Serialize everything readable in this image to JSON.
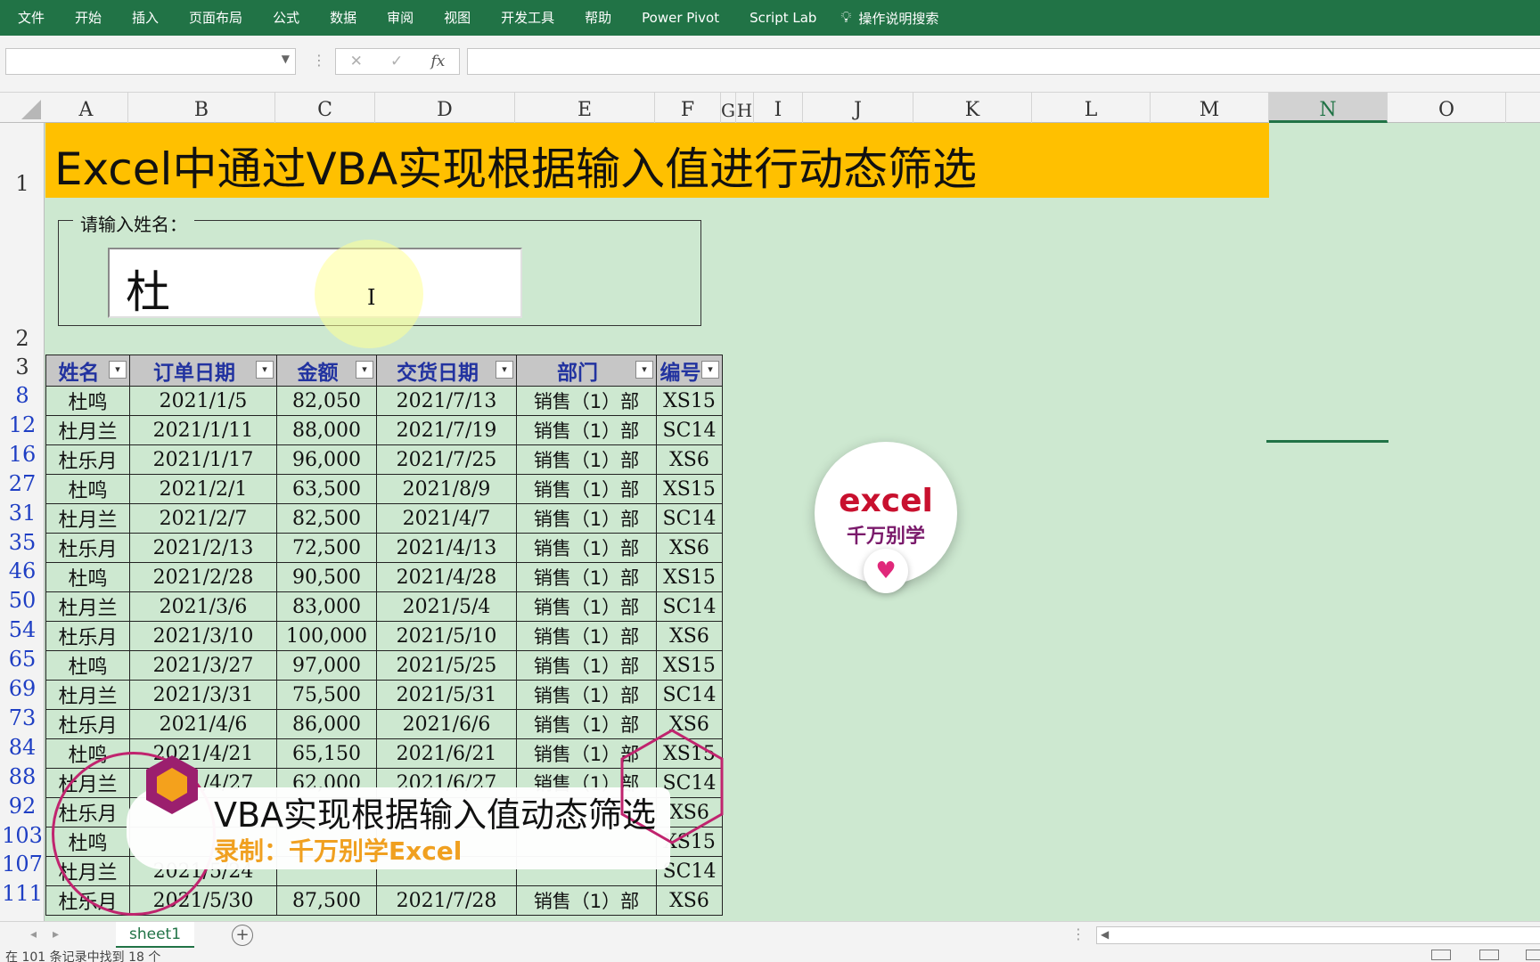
{
  "ribbon": {
    "tabs": [
      "文件",
      "开始",
      "插入",
      "页面布局",
      "公式",
      "数据",
      "审阅",
      "视图",
      "开发工具",
      "帮助",
      "Power Pivot",
      "Script Lab"
    ],
    "search_label": "操作说明搜索"
  },
  "formula_bar": {
    "fx": "fx",
    "cancel": "✕",
    "enter": "✓",
    "name_box": "",
    "content": ""
  },
  "columns": [
    "A",
    "B",
    "C",
    "D",
    "E",
    "F",
    "G",
    "H",
    "I",
    "J",
    "K",
    "L",
    "M",
    "N",
    "O"
  ],
  "selected_column": "N",
  "rows_plain": [
    "1",
    "2",
    "3"
  ],
  "banner_title": "Excel中通过VBA实现根据输入值进行动态筛选",
  "input_group": {
    "legend": "请输入姓名：",
    "value": "杜"
  },
  "table": {
    "headers": [
      "姓名",
      "订单日期",
      "金额",
      "交货日期",
      "部门",
      "编号"
    ],
    "rows": [
      {
        "row": "8",
        "cells": [
          "杜鸣",
          "2021/1/5",
          "82,050",
          "2021/7/13",
          "销售（1）部",
          "XS15"
        ]
      },
      {
        "row": "12",
        "cells": [
          "杜月兰",
          "2021/1/11",
          "88,000",
          "2021/7/19",
          "销售（1）部",
          "SC14"
        ]
      },
      {
        "row": "16",
        "cells": [
          "杜乐月",
          "2021/1/17",
          "96,000",
          "2021/7/25",
          "销售（1）部",
          "XS6"
        ]
      },
      {
        "row": "27",
        "cells": [
          "杜鸣",
          "2021/2/1",
          "63,500",
          "2021/8/9",
          "销售（1）部",
          "XS15"
        ]
      },
      {
        "row": "31",
        "cells": [
          "杜月兰",
          "2021/2/7",
          "82,500",
          "2021/4/7",
          "销售（1）部",
          "SC14"
        ]
      },
      {
        "row": "35",
        "cells": [
          "杜乐月",
          "2021/2/13",
          "72,500",
          "2021/4/13",
          "销售（1）部",
          "XS6"
        ]
      },
      {
        "row": "46",
        "cells": [
          "杜鸣",
          "2021/2/28",
          "90,500",
          "2021/4/28",
          "销售（1）部",
          "XS15"
        ]
      },
      {
        "row": "50",
        "cells": [
          "杜月兰",
          "2021/3/6",
          "83,000",
          "2021/5/4",
          "销售（1）部",
          "SC14"
        ]
      },
      {
        "row": "54",
        "cells": [
          "杜乐月",
          "2021/3/10",
          "100,000",
          "2021/5/10",
          "销售（1）部",
          "XS6"
        ]
      },
      {
        "row": "65",
        "cells": [
          "杜鸣",
          "2021/3/27",
          "97,000",
          "2021/5/25",
          "销售（1）部",
          "XS15"
        ]
      },
      {
        "row": "69",
        "cells": [
          "杜月兰",
          "2021/3/31",
          "75,500",
          "2021/5/31",
          "销售（1）部",
          "SC14"
        ]
      },
      {
        "row": "73",
        "cells": [
          "杜乐月",
          "2021/4/6",
          "86,000",
          "2021/6/6",
          "销售（1）部",
          "XS6"
        ]
      },
      {
        "row": "84",
        "cells": [
          "杜鸣",
          "2021/4/21",
          "65,150",
          "2021/6/21",
          "销售（1）部",
          "XS15"
        ]
      },
      {
        "row": "88",
        "cells": [
          "杜月兰",
          "2021/4/27",
          "62,000",
          "2021/6/27",
          "销售（1）部",
          "SC14"
        ]
      },
      {
        "row": "92",
        "cells": [
          "杜乐月",
          "",
          "",
          "",
          "",
          "XS6"
        ]
      },
      {
        "row": "103",
        "cells": [
          "杜鸣",
          "",
          "",
          "",
          "",
          "XS15"
        ]
      },
      {
        "row": "107",
        "cells": [
          "杜月兰",
          "2021/5/24",
          "",
          "",
          "",
          "SC14"
        ]
      },
      {
        "row": "111",
        "cells": [
          "杜乐月",
          "2021/5/30",
          "87,500",
          "2021/7/28",
          "销售（1）部",
          "XS6"
        ]
      }
    ]
  },
  "logo": {
    "line1": "excel",
    "line2": "千万别学"
  },
  "overlay": {
    "title": "VBA实现根据输入值动态筛选",
    "subtitle": "录制：千万别学Excel"
  },
  "sheet_tabs": {
    "active": "sheet1"
  },
  "status_text": "在 101 条记录中找到 18 个",
  "colors": {
    "ribbon": "#217346",
    "banner": "#ffc000",
    "sheet_bg": "#cde8d0",
    "header_text": "#2233a0",
    "filtered_row_number": "#1f3fc4",
    "overlay_accent": "#c0246e"
  }
}
